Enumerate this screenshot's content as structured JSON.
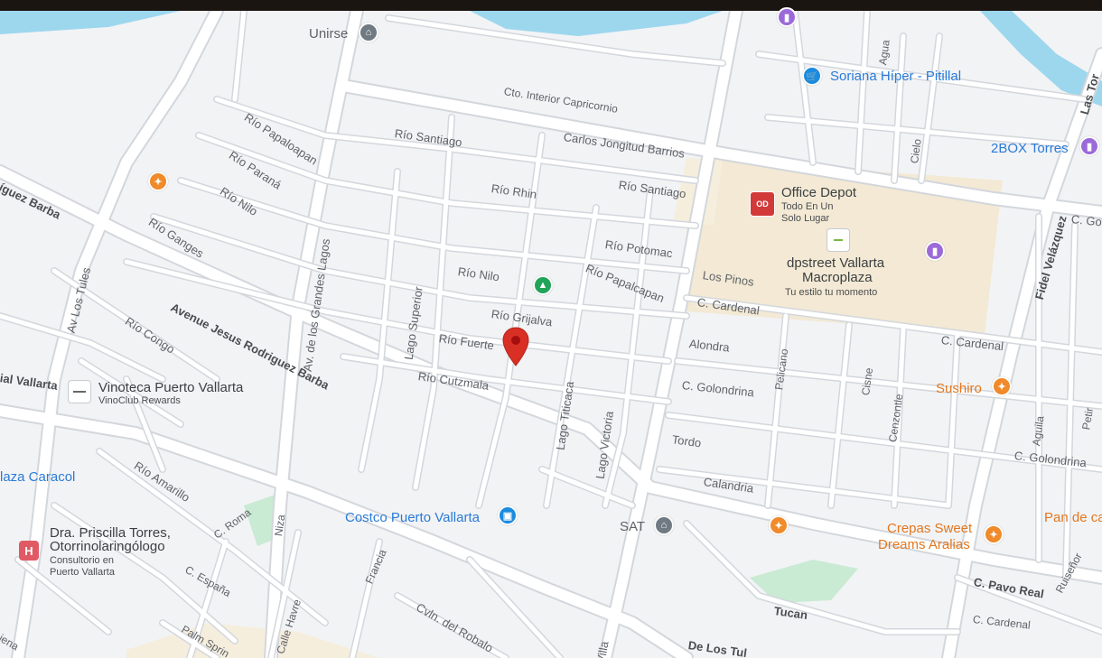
{
  "map": {
    "selected_pin": {
      "icon": "red-location-pin-icon"
    },
    "streets": [
      {
        "id": "cto-interior",
        "text": "Cto. Interior Capricornio"
      },
      {
        "id": "carlos",
        "text": "Carlos Jongitud Barrios"
      },
      {
        "id": "rio-santiago-1",
        "text": "Río Santiago"
      },
      {
        "id": "rio-santiago-2",
        "text": "Río Santiago"
      },
      {
        "id": "rio-papaloapan-1",
        "text": "Río Papaloapan"
      },
      {
        "id": "rio-parana",
        "text": "Río Paraná"
      },
      {
        "id": "rio-nilo-1",
        "text": "Río Nilo"
      },
      {
        "id": "rio-rhin",
        "text": "Río Rhin"
      },
      {
        "id": "rio-potomac",
        "text": "Río Potomac"
      },
      {
        "id": "rio-papalcapan",
        "text": "Río Papalcapan"
      },
      {
        "id": "rio-nilo-2",
        "text": "Río Nilo"
      },
      {
        "id": "rio-grijalva",
        "text": "Río Grijalva"
      },
      {
        "id": "rio-fuerte",
        "text": "Río Fuerte"
      },
      {
        "id": "rio-cutzmala",
        "text": "Río Cutzmala"
      },
      {
        "id": "rio-ganges",
        "text": "Río Ganges"
      },
      {
        "id": "rio-congo",
        "text": "Río Congo"
      },
      {
        "id": "rio-amarillo",
        "text": "Río Amarillo"
      },
      {
        "id": "avenue-jesus",
        "text": "Avenue Jesus Rodriguez Barba"
      },
      {
        "id": "av-grandes-lagos",
        "text": "Av. de los Grandes Lagos"
      },
      {
        "id": "lago-superior",
        "text": "Lago Superior"
      },
      {
        "id": "lago-titicaca",
        "text": "Lago Titicaca"
      },
      {
        "id": "lago-victoria",
        "text": "Lago Victoria"
      },
      {
        "id": "av-tules",
        "text": "Av Los Tules"
      },
      {
        "id": "guez-barba",
        "text": "íguez Barba"
      },
      {
        "id": "ial-vallarta",
        "text": "ial Vallarta"
      },
      {
        "id": "los-pinos",
        "text": "Los Pinos"
      },
      {
        "id": "c-cardenal-1",
        "text": "C. Cardenal"
      },
      {
        "id": "c-cardenal-2",
        "text": "C. Cardenal"
      },
      {
        "id": "c-cardenal-3",
        "text": "C. Cardenal"
      },
      {
        "id": "alondra",
        "text": "Alondra"
      },
      {
        "id": "c-golondrina-1",
        "text": "C. Golondrina"
      },
      {
        "id": "c-golondrina-2",
        "text": "C. Golondrina"
      },
      {
        "id": "tordo",
        "text": "Tordo"
      },
      {
        "id": "calandria",
        "text": "Calandria"
      },
      {
        "id": "pelicano",
        "text": "Pelicano"
      },
      {
        "id": "cisne",
        "text": "Cisne"
      },
      {
        "id": "cenzontle",
        "text": "Cenzontle"
      },
      {
        "id": "aguila",
        "text": "Aguila"
      },
      {
        "id": "agua",
        "text": "Agua"
      },
      {
        "id": "cielo",
        "text": "Cielo"
      },
      {
        "id": "fidel",
        "text": "Fidel Velázquez"
      },
      {
        "id": "las-torres",
        "text": "Las Tor"
      },
      {
        "id": "c-go",
        "text": "C. Go"
      },
      {
        "id": "c-pavo-real",
        "text": "C. Pavo Real"
      },
      {
        "id": "tucan",
        "text": "Tucan"
      },
      {
        "id": "ruiseñor",
        "text": "Ruiseñor"
      },
      {
        "id": "petir",
        "text": "Petir"
      },
      {
        "id": "de-los-tules",
        "text": "De Los Tul"
      },
      {
        "id": "villa",
        "text": "Villa"
      },
      {
        "id": "cvln-robalo",
        "text": "Cvln. del Robalo"
      },
      {
        "id": "c-roma",
        "text": "C. Roma"
      },
      {
        "id": "niza",
        "text": "Niza"
      },
      {
        "id": "c-espana",
        "text": "C. España"
      },
      {
        "id": "francia",
        "text": "Francia"
      },
      {
        "id": "calle-havre",
        "text": "Calle Havre"
      },
      {
        "id": "palm-spring",
        "text": "Palm Sprin"
      },
      {
        "id": "iena",
        "text": "iena"
      }
    ],
    "pois": {
      "unirse": "Unirse",
      "soriana": "Soriana Híper - Pitillal",
      "twobox": "2BOX Torres",
      "office_depot": "Office Depot",
      "office_depot_sub1": "Todo En Un",
      "office_depot_sub2": "Solo Lugar",
      "dpstreet_1": "dpstreet Vallarta",
      "dpstreet_2": "Macroplaza",
      "dpstreet_sub": "Tu estilo tu momento",
      "vinoteca": "Vinoteca Puerto Vallarta",
      "vinoteca_sub": "VinoClub Rewards",
      "plaza_caracol": "laza Caracol",
      "dra_1": "Dra. Priscilla Torres,",
      "dra_2": "Otorrinolaringólogo",
      "dra_sub1": "Consultorio en",
      "dra_sub2": "Puerto Vallarta",
      "costco": "Costco Puerto Vallarta",
      "sat": "SAT",
      "sushiro": "Sushiro",
      "crepas_1": "Crepas Sweet",
      "crepas_2": "Dreams Aralias",
      "pan": "Pan de ca"
    },
    "colors": {
      "water": "#9dd7ee",
      "road": "#ffffff",
      "road_edge": "#d3d7dc",
      "commercial": "#f3e9d4",
      "park": "#c9ead3",
      "selected_pin": "#d93025"
    }
  }
}
